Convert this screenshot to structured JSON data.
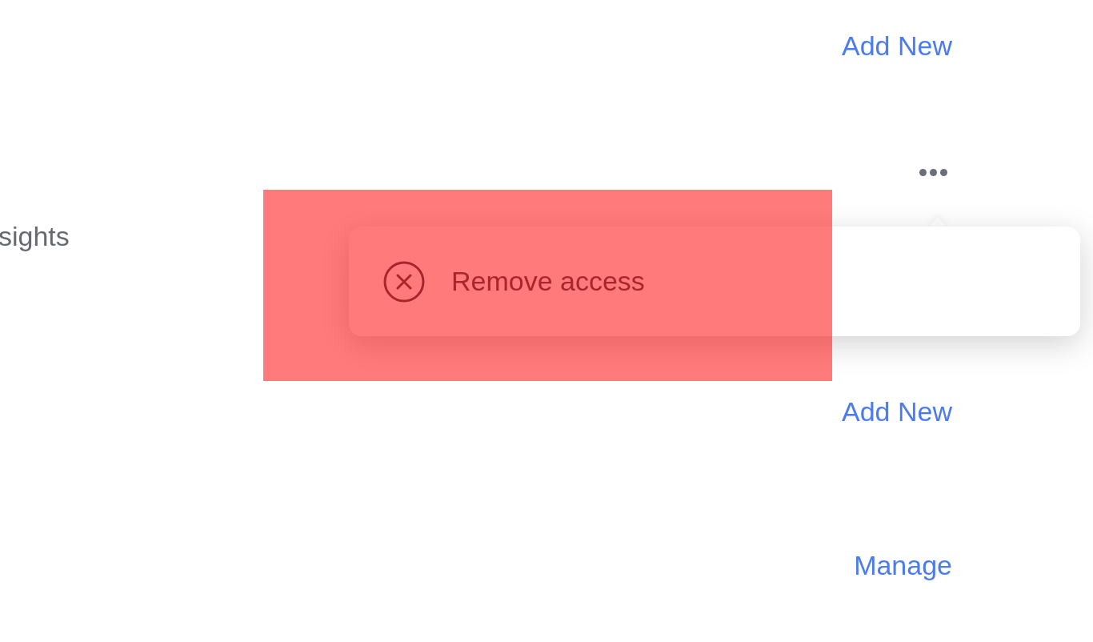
{
  "left_text": "sights",
  "actions": [
    {
      "kind": "link",
      "label": "Add New"
    },
    {
      "kind": "more"
    },
    {
      "kind": "link",
      "label": "Add New"
    },
    {
      "kind": "link",
      "label": "Manage"
    }
  ],
  "menu": {
    "items": [
      {
        "label": "Remove access"
      }
    ]
  },
  "annotation": {
    "kind": "highlight"
  }
}
